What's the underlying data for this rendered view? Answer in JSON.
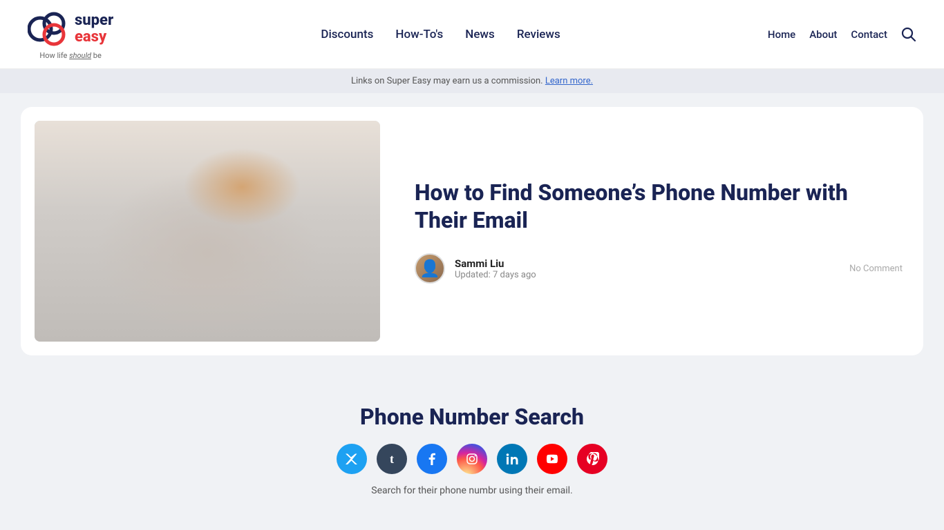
{
  "header": {
    "logo_brand": "super easy",
    "logo_super": "super",
    "logo_easy": "easy",
    "logo_tagline_prefix": "How life ",
    "logo_tagline_italic": "should",
    "logo_tagline_suffix": " be",
    "nav": {
      "items": [
        {
          "label": "Discounts",
          "href": "#"
        },
        {
          "label": "How-To's",
          "href": "#"
        },
        {
          "label": "News",
          "href": "#"
        },
        {
          "label": "Reviews",
          "href": "#"
        }
      ]
    },
    "right_nav": {
      "items": [
        {
          "label": "Home",
          "href": "#"
        },
        {
          "label": "About",
          "href": "#"
        },
        {
          "label": "Contact",
          "href": "#"
        }
      ]
    }
  },
  "commission_bar": {
    "text_prefix": "Links on Super Easy may earn us a commission. ",
    "learn_more": "Learn more."
  },
  "article": {
    "title": "How to Find Someone’s Phone Number with Their Email",
    "author_name": "Sammi Liu",
    "updated": "Updated: 7 days ago",
    "no_comment": "No Comment"
  },
  "phone_search": {
    "title": "Phone Number Search",
    "description": "Search for their phone numbr using their email.",
    "social_icons": [
      {
        "name": "twitter",
        "class": "si-twitter",
        "symbol": "𝕏"
      },
      {
        "name": "tumblr",
        "class": "si-tumblr",
        "symbol": "t"
      },
      {
        "name": "facebook",
        "class": "si-facebook",
        "symbol": "f"
      },
      {
        "name": "instagram",
        "class": "si-instagram",
        "symbol": "📷"
      },
      {
        "name": "linkedin",
        "class": "si-linkedin",
        "symbol": "in"
      },
      {
        "name": "youtube",
        "class": "si-youtube",
        "symbol": "▶"
      },
      {
        "name": "pinterest",
        "class": "si-pinterest",
        "symbol": "P"
      }
    ]
  }
}
